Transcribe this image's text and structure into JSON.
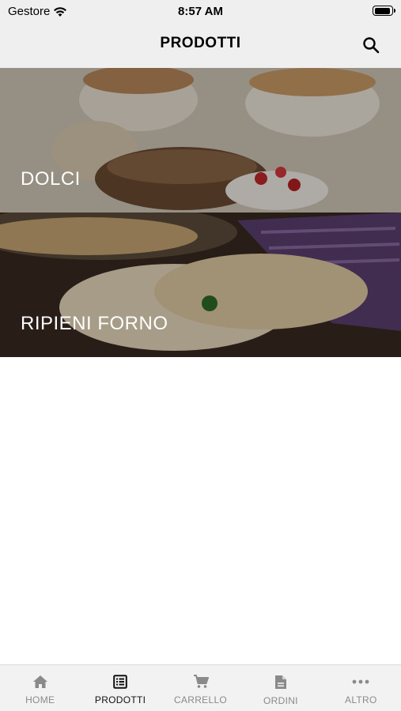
{
  "status": {
    "carrier": "Gestore",
    "time": "8:57 AM"
  },
  "header": {
    "title": "PRODOTTI",
    "search_icon": "search-icon"
  },
  "categories": [
    {
      "label": "DOLCI"
    },
    {
      "label": "RIPIENI FORNO"
    }
  ],
  "tabs": [
    {
      "label": "HOME",
      "icon": "home-icon",
      "active": false
    },
    {
      "label": "PRODOTTI",
      "icon": "list-icon",
      "active": true
    },
    {
      "label": "CARRELLO",
      "icon": "cart-icon",
      "active": false
    },
    {
      "label": "ORDINI",
      "icon": "document-icon",
      "active": false
    },
    {
      "label": "ALTRO",
      "icon": "more-icon",
      "active": false
    }
  ],
  "colors": {
    "bar_bg": "#efefef",
    "tab_active": "#111111",
    "tab_inactive": "#8a8a8a"
  }
}
